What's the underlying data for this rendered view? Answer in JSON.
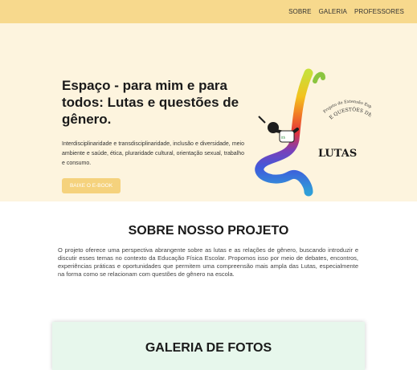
{
  "nav": {
    "items": [
      {
        "label": "SOBRE"
      },
      {
        "label": "GALERIA"
      },
      {
        "label": "PROFESSORES"
      }
    ]
  },
  "hero": {
    "title": "Espaço - para mim e para todos: Lutas e questões de gênero.",
    "description": "Interdisciplinaridade e transdisciplinaridade, inclusão e diversidade, meio ambiente e saúde, ética, pluraridade cultural, orientação sexual, trabalho e consumo.",
    "button_label": "BAIXE O E-BOOK",
    "art": {
      "logo_text": "LUTAS",
      "curved_text_outer": "Projeto de Extensão Espaço - para mim e para todos",
      "curved_text_inner": "E QUESTÕES DE GÊNERO"
    }
  },
  "about": {
    "title": "SOBRE NOSSO PROJETO",
    "text": "O projeto oferece uma perspectiva abrangente sobre as lutas e as relações de gênero, buscando introduzir e discutir esses temas no contexto da Educação Física Escolar. Propomos isso por meio de debates, encontros, experiências práticas e oportunidades que permitem uma compreensão mais ampla das Lutas, especialmente na forma como se relacionam com questões de gênero na escola."
  },
  "gallery": {
    "title": "GALERIA DE FOTOS"
  },
  "colors": {
    "topbar": "#f7d98d",
    "hero_bg": "#fdf4de",
    "button": "#f5d27d",
    "gallery_bg": "#e7f7ec"
  }
}
